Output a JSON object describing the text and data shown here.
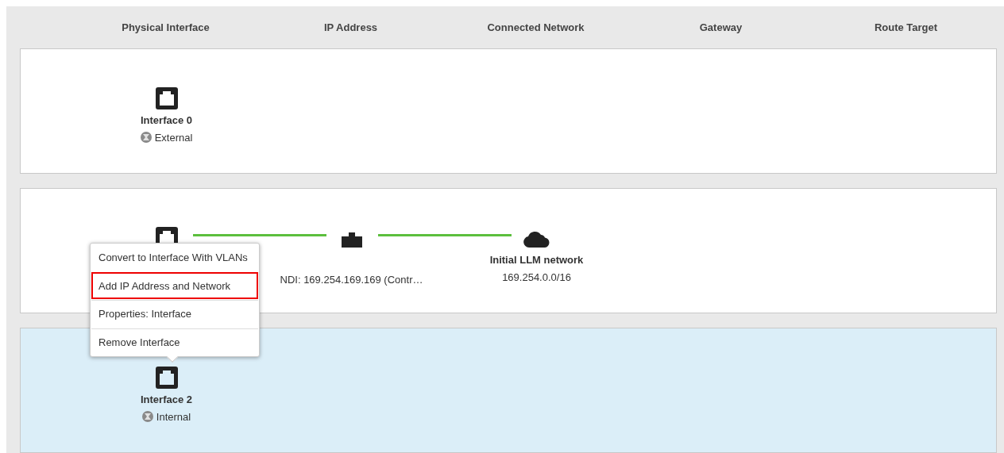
{
  "columns": [
    "Physical Interface",
    "IP Address",
    "Connected Network",
    "Gateway",
    "Route Target"
  ],
  "rows": [
    {
      "selected": false,
      "nodes": [
        {
          "kind": "interface",
          "name": "Interface 0",
          "zone": "External"
        }
      ]
    },
    {
      "selected": false,
      "nodes": [
        {
          "kind": "interface"
        },
        {
          "kind": "ip",
          "label": "NDI: 169.254.169.169 (Contr…",
          "linked": true
        },
        {
          "kind": "network",
          "name": "Initial LLM network",
          "subnet": "169.254.0.0/16",
          "linked": true
        }
      ]
    },
    {
      "selected": true,
      "nodes": [
        {
          "kind": "interface",
          "name": "Interface 2",
          "zone": "Internal"
        }
      ]
    }
  ],
  "context_menu": {
    "items": [
      {
        "label": "Convert to Interface With VLANs",
        "highlighted": false
      },
      {
        "label": "Add IP Address and Network",
        "highlighted": true
      },
      {
        "label": "Properties: Interface",
        "highlighted": false
      },
      {
        "label": "Remove Interface",
        "highlighted": false
      }
    ]
  }
}
